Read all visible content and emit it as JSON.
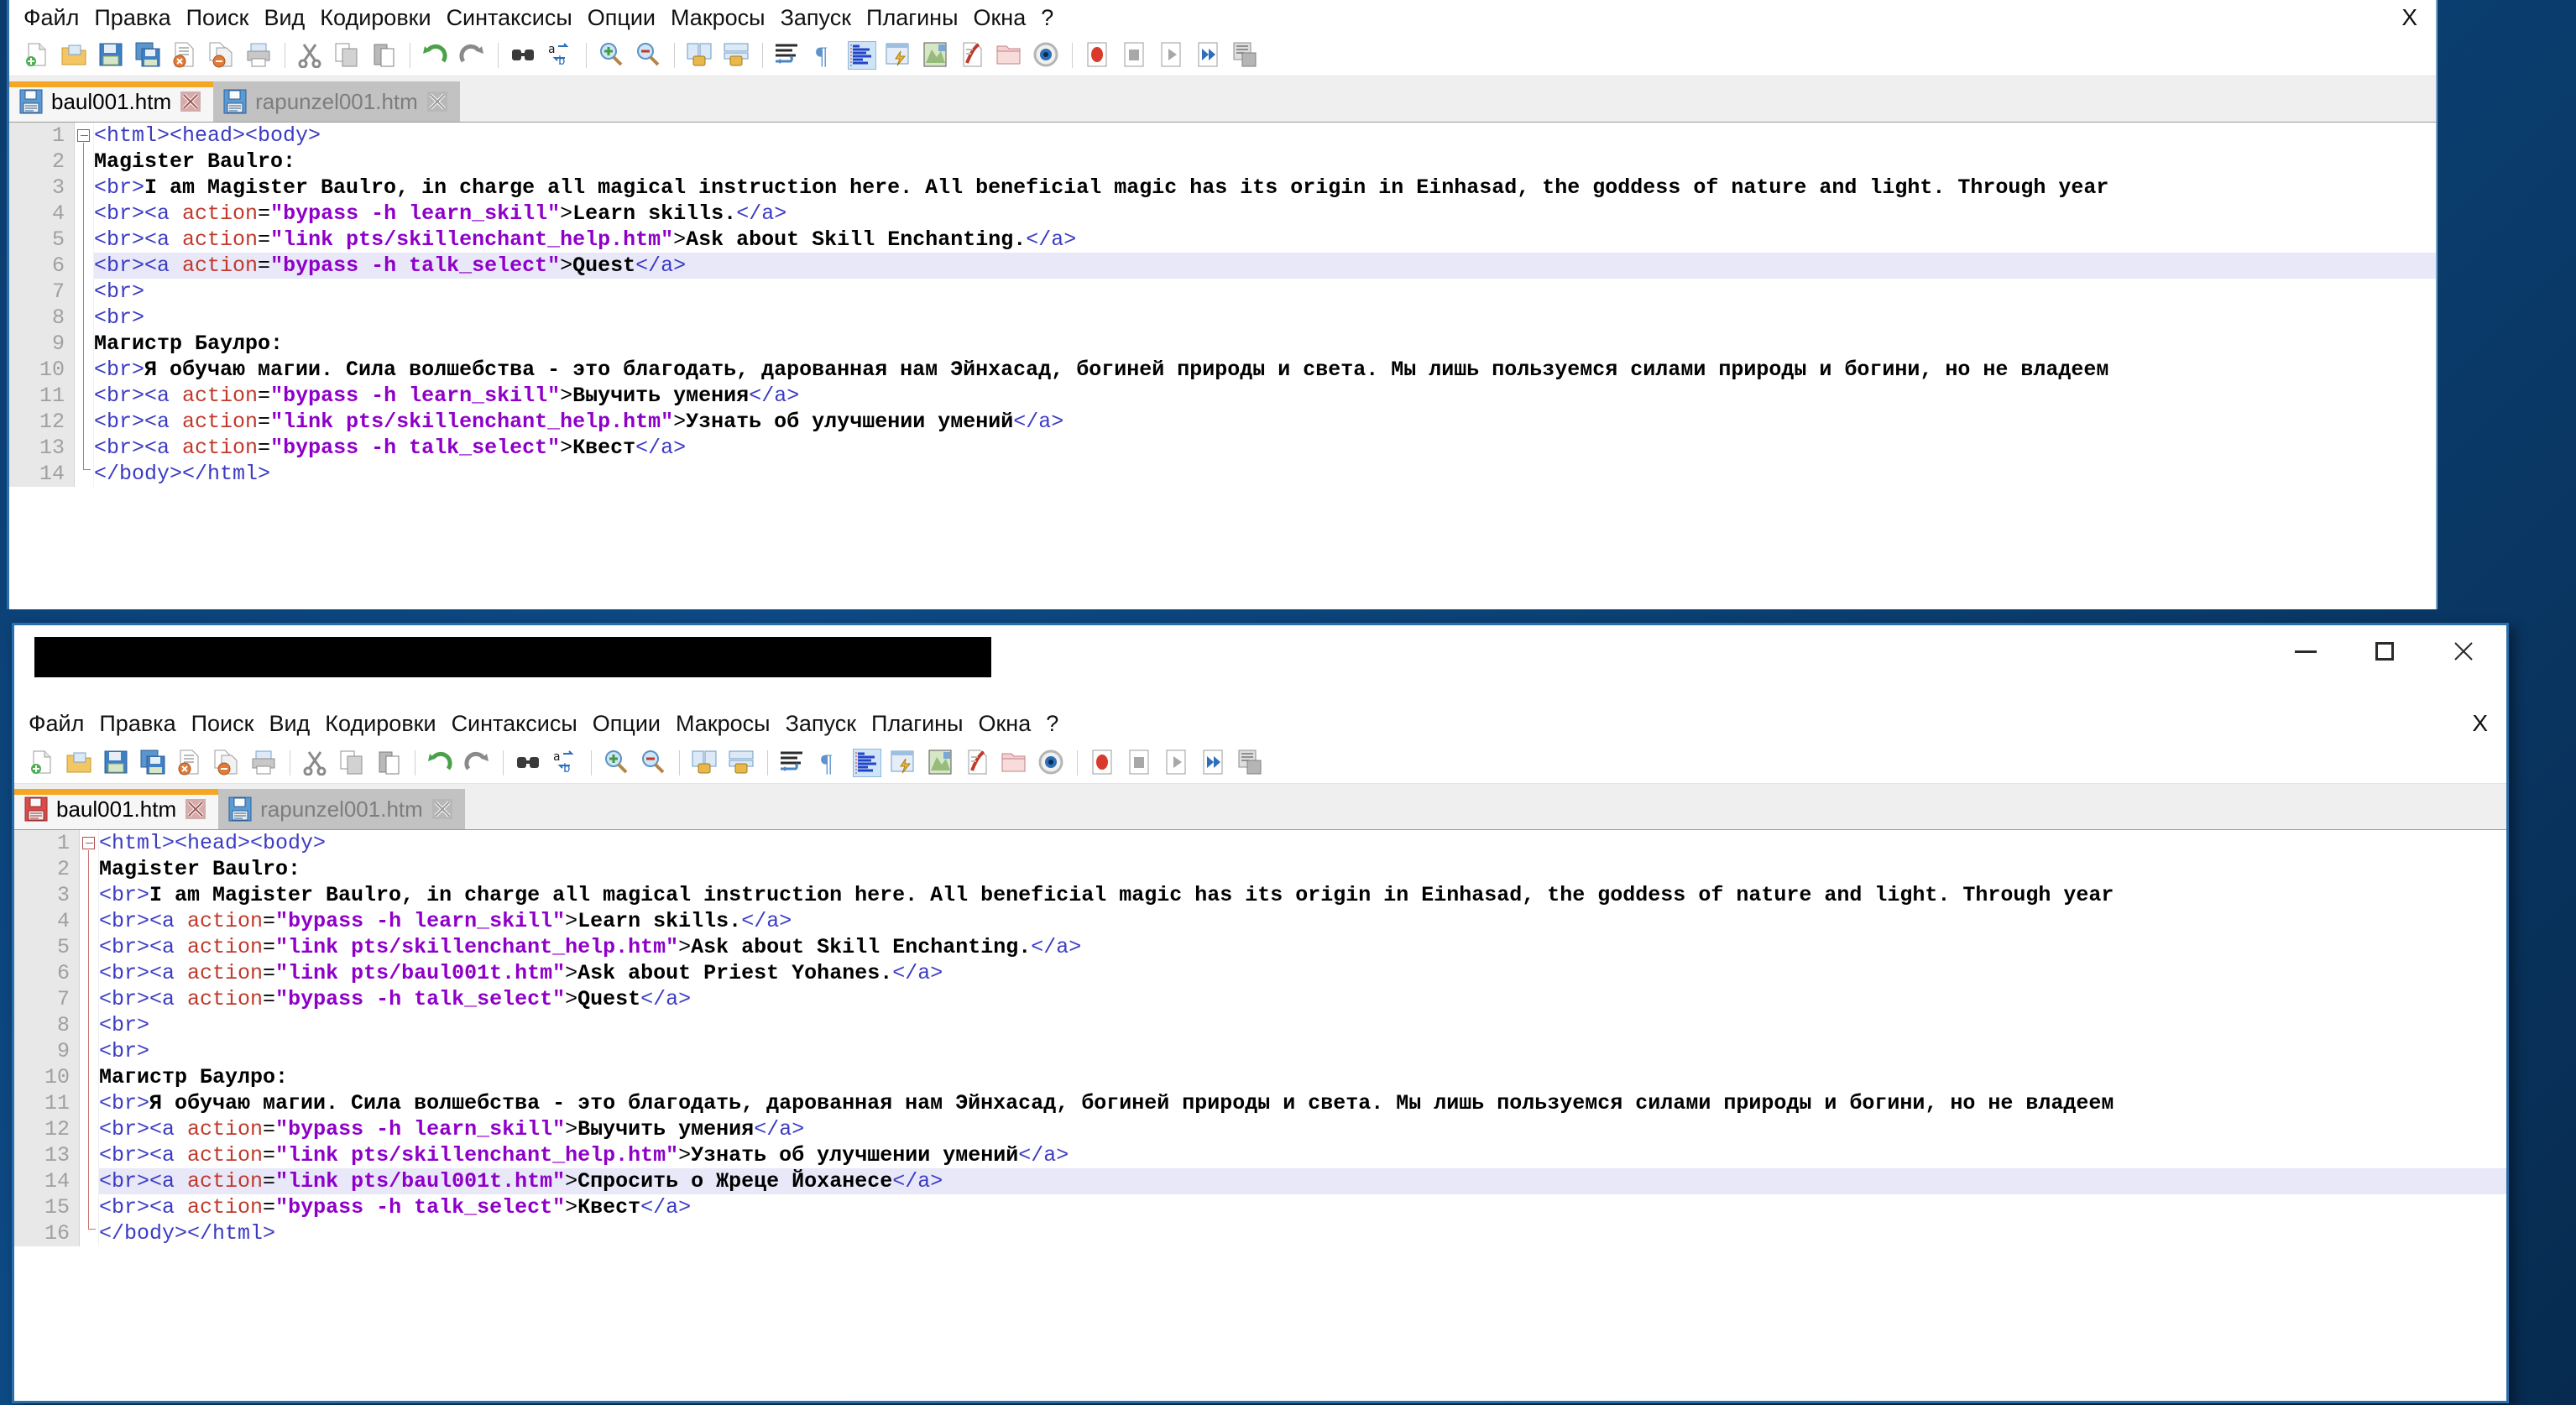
{
  "app": {
    "name": "Notepad++",
    "menu": [
      "Файл",
      "Правка",
      "Поиск",
      "Вид",
      "Кодировки",
      "Синтаксисы",
      "Опции",
      "Макросы",
      "Запуск",
      "Плагины",
      "Окна",
      "?"
    ],
    "doc_close_label": "X",
    "window_controls": {
      "minimize": "–",
      "maximize": "□",
      "close": "✕"
    },
    "toolbar_icons": [
      "new-file-icon",
      "open-folder-icon",
      "save-icon",
      "save-all-icon",
      "close-file-icon",
      "close-all-files-icon",
      "print-icon",
      "sep",
      "cut-icon",
      "copy-icon",
      "paste-icon",
      "sep",
      "undo-icon",
      "redo-icon",
      "sep",
      "find-icon",
      "replace-icon",
      "sep",
      "zoom-in-icon",
      "zoom-out-icon",
      "sep",
      "sync-vertical-scroll-icon",
      "sync-horizontal-scroll-icon",
      "sep",
      "word-wrap-icon",
      "show-all-chars-icon",
      "indent-guide-icon",
      "user-defined-dialog-icon",
      "show-document-map-icon",
      "function-list-icon",
      "folder-as-workspace-icon",
      "monitoring-icon",
      "sep",
      "macro-record-icon",
      "macro-stop-icon",
      "macro-playback-icon",
      "macro-run-multiple-icon",
      "macro-save-icon"
    ]
  },
  "windows": [
    {
      "id": "top-window",
      "title_visible": false,
      "title_redacted": false,
      "tabs": [
        {
          "label": "baul001.htm",
          "active": true,
          "modified": false,
          "icon": "floppy-blue-icon",
          "close_icon": "close-tab-icon"
        },
        {
          "label": "rapunzel001.htm",
          "active": false,
          "modified": false,
          "icon": "floppy-blue-icon",
          "close_icon": "close-tab-icon"
        }
      ],
      "current_line": 6,
      "line_numbers": [
        1,
        2,
        3,
        4,
        5,
        6,
        7,
        8,
        9,
        10,
        11,
        12,
        13,
        14
      ],
      "lines": [
        {
          "n": 1,
          "parts": [
            {
              "t": "tag",
              "s": "<html><head><body>"
            }
          ]
        },
        {
          "n": 2,
          "parts": [
            {
              "t": "txt",
              "s": "Magister Baulro:"
            }
          ]
        },
        {
          "n": 3,
          "parts": [
            {
              "t": "tag",
              "s": "<br>"
            },
            {
              "t": "txt",
              "s": "I am Magister Baulro, in charge all magical instruction here. All beneficial magic has its origin in Einhasad, the goddess of nature and light. Through year"
            }
          ]
        },
        {
          "n": 4,
          "parts": [
            {
              "t": "tag",
              "s": "<br><a "
            },
            {
              "t": "attr",
              "s": "action"
            },
            {
              "t": "punct",
              "s": "="
            },
            {
              "t": "val",
              "s": "\"bypass -h learn_skill\""
            },
            {
              "t": "punct",
              "s": ">"
            },
            {
              "t": "txt",
              "s": "Learn skills."
            },
            {
              "t": "tag",
              "s": "</a>"
            }
          ]
        },
        {
          "n": 5,
          "parts": [
            {
              "t": "tag",
              "s": "<br><a "
            },
            {
              "t": "attr",
              "s": "action"
            },
            {
              "t": "punct",
              "s": "="
            },
            {
              "t": "val",
              "s": "\"link pts/skillenchant_help.htm\""
            },
            {
              "t": "punct",
              "s": ">"
            },
            {
              "t": "txt",
              "s": "Ask about Skill Enchanting."
            },
            {
              "t": "tag",
              "s": "</a>"
            }
          ]
        },
        {
          "n": 6,
          "parts": [
            {
              "t": "tag",
              "s": "<br><a "
            },
            {
              "t": "attr",
              "s": "action"
            },
            {
              "t": "punct",
              "s": "="
            },
            {
              "t": "val",
              "s": "\"bypass -h talk_select\""
            },
            {
              "t": "punct",
              "s": ">"
            },
            {
              "t": "txt",
              "s": "Quest"
            },
            {
              "t": "tag",
              "s": "</a>"
            }
          ]
        },
        {
          "n": 7,
          "parts": [
            {
              "t": "tag",
              "s": "<br>"
            }
          ]
        },
        {
          "n": 8,
          "parts": [
            {
              "t": "tag",
              "s": "<br>"
            }
          ]
        },
        {
          "n": 9,
          "parts": [
            {
              "t": "txt",
              "s": "Магистр Баулро:"
            }
          ]
        },
        {
          "n": 10,
          "parts": [
            {
              "t": "tag",
              "s": "<br>"
            },
            {
              "t": "txt",
              "s": "Я обучаю магии. Сила волшебства - это благодать, дарованная нам Эйнхасад, богиней природы и света. Мы лишь пользуемся силами природы и богини, но не владеем"
            }
          ]
        },
        {
          "n": 11,
          "parts": [
            {
              "t": "tag",
              "s": "<br><a "
            },
            {
              "t": "attr",
              "s": "action"
            },
            {
              "t": "punct",
              "s": "="
            },
            {
              "t": "val",
              "s": "\"bypass -h learn_skill\""
            },
            {
              "t": "punct",
              "s": ">"
            },
            {
              "t": "txt",
              "s": "Выучить умения"
            },
            {
              "t": "tag",
              "s": "</a>"
            }
          ]
        },
        {
          "n": 12,
          "parts": [
            {
              "t": "tag",
              "s": "<br><a "
            },
            {
              "t": "attr",
              "s": "action"
            },
            {
              "t": "punct",
              "s": "="
            },
            {
              "t": "val",
              "s": "\"link pts/skillenchant_help.htm\""
            },
            {
              "t": "punct",
              "s": ">"
            },
            {
              "t": "txt",
              "s": "Узнать об улучшении умений"
            },
            {
              "t": "tag",
              "s": "</a>"
            }
          ]
        },
        {
          "n": 13,
          "parts": [
            {
              "t": "tag",
              "s": "<br><a "
            },
            {
              "t": "attr",
              "s": "action"
            },
            {
              "t": "punct",
              "s": "="
            },
            {
              "t": "val",
              "s": "\"bypass -h talk_select\""
            },
            {
              "t": "punct",
              "s": ">"
            },
            {
              "t": "txt",
              "s": "Квест"
            },
            {
              "t": "tag",
              "s": "</a>"
            }
          ]
        },
        {
          "n": 14,
          "parts": [
            {
              "t": "tag",
              "s": "</body></html>"
            }
          ]
        }
      ]
    },
    {
      "id": "bottom-window",
      "title_visible": false,
      "title_redacted": true,
      "tabs": [
        {
          "label": "baul001.htm",
          "active": true,
          "modified": true,
          "icon": "floppy-red-icon",
          "close_icon": "close-tab-icon"
        },
        {
          "label": "rapunzel001.htm",
          "active": false,
          "modified": false,
          "icon": "floppy-blue-icon",
          "close_icon": "close-tab-icon"
        }
      ],
      "current_line": 14,
      "line_numbers": [
        1,
        2,
        3,
        4,
        5,
        6,
        7,
        8,
        9,
        10,
        11,
        12,
        13,
        14,
        15,
        16
      ],
      "lines": [
        {
          "n": 1,
          "parts": [
            {
              "t": "tag",
              "s": "<html><head><body>"
            }
          ]
        },
        {
          "n": 2,
          "parts": [
            {
              "t": "txt",
              "s": "Magister Baulro:"
            }
          ]
        },
        {
          "n": 3,
          "parts": [
            {
              "t": "tag",
              "s": "<br>"
            },
            {
              "t": "txt",
              "s": "I am Magister Baulro, in charge all magical instruction here. All beneficial magic has its origin in Einhasad, the goddess of nature and light. Through year"
            }
          ]
        },
        {
          "n": 4,
          "parts": [
            {
              "t": "tag",
              "s": "<br><a "
            },
            {
              "t": "attr",
              "s": "action"
            },
            {
              "t": "punct",
              "s": "="
            },
            {
              "t": "val",
              "s": "\"bypass -h learn_skill\""
            },
            {
              "t": "punct",
              "s": ">"
            },
            {
              "t": "txt",
              "s": "Learn skills."
            },
            {
              "t": "tag",
              "s": "</a>"
            }
          ]
        },
        {
          "n": 5,
          "parts": [
            {
              "t": "tag",
              "s": "<br><a "
            },
            {
              "t": "attr",
              "s": "action"
            },
            {
              "t": "punct",
              "s": "="
            },
            {
              "t": "val",
              "s": "\"link pts/skillenchant_help.htm\""
            },
            {
              "t": "punct",
              "s": ">"
            },
            {
              "t": "txt",
              "s": "Ask about Skill Enchanting."
            },
            {
              "t": "tag",
              "s": "</a>"
            }
          ]
        },
        {
          "n": 6,
          "parts": [
            {
              "t": "tag",
              "s": "<br><a "
            },
            {
              "t": "attr",
              "s": "action"
            },
            {
              "t": "punct",
              "s": "="
            },
            {
              "t": "val",
              "s": "\"link pts/baul001t.htm\""
            },
            {
              "t": "punct",
              "s": ">"
            },
            {
              "t": "txt",
              "s": "Ask about Priest Yohanes."
            },
            {
              "t": "tag",
              "s": "</a>"
            }
          ]
        },
        {
          "n": 7,
          "parts": [
            {
              "t": "tag",
              "s": "<br><a "
            },
            {
              "t": "attr",
              "s": "action"
            },
            {
              "t": "punct",
              "s": "="
            },
            {
              "t": "val",
              "s": "\"bypass -h talk_select\""
            },
            {
              "t": "punct",
              "s": ">"
            },
            {
              "t": "txt",
              "s": "Quest"
            },
            {
              "t": "tag",
              "s": "</a>"
            }
          ]
        },
        {
          "n": 8,
          "parts": [
            {
              "t": "tag",
              "s": "<br>"
            }
          ]
        },
        {
          "n": 9,
          "parts": [
            {
              "t": "tag",
              "s": "<br>"
            }
          ]
        },
        {
          "n": 10,
          "parts": [
            {
              "t": "txt",
              "s": "Магистр Баулро:"
            }
          ]
        },
        {
          "n": 11,
          "parts": [
            {
              "t": "tag",
              "s": "<br>"
            },
            {
              "t": "txt",
              "s": "Я обучаю магии. Сила волшебства - это благодать, дарованная нам Эйнхасад, богиней природы и света. Мы лишь пользуемся силами природы и богини, но не владеем"
            }
          ]
        },
        {
          "n": 12,
          "parts": [
            {
              "t": "tag",
              "s": "<br><a "
            },
            {
              "t": "attr",
              "s": "action"
            },
            {
              "t": "punct",
              "s": "="
            },
            {
              "t": "val",
              "s": "\"bypass -h learn_skill\""
            },
            {
              "t": "punct",
              "s": ">"
            },
            {
              "t": "txt",
              "s": "Выучить умения"
            },
            {
              "t": "tag",
              "s": "</a>"
            }
          ]
        },
        {
          "n": 13,
          "parts": [
            {
              "t": "tag",
              "s": "<br><a "
            },
            {
              "t": "attr",
              "s": "action"
            },
            {
              "t": "punct",
              "s": "="
            },
            {
              "t": "val",
              "s": "\"link pts/skillenchant_help.htm\""
            },
            {
              "t": "punct",
              "s": ">"
            },
            {
              "t": "txt",
              "s": "Узнать об улучшении умений"
            },
            {
              "t": "tag",
              "s": "</a>"
            }
          ]
        },
        {
          "n": 14,
          "parts": [
            {
              "t": "tag",
              "s": "<br><a "
            },
            {
              "t": "attr",
              "s": "action"
            },
            {
              "t": "punct",
              "s": "="
            },
            {
              "t": "val",
              "s": "\"link pts/baul001t.htm\""
            },
            {
              "t": "punct",
              "s": ">"
            },
            {
              "t": "txt",
              "s": "Спросить о Жреце Йоханесе"
            },
            {
              "t": "tag",
              "s": "</a>"
            }
          ]
        },
        {
          "n": 15,
          "parts": [
            {
              "t": "tag",
              "s": "<br><a "
            },
            {
              "t": "attr",
              "s": "action"
            },
            {
              "t": "punct",
              "s": "="
            },
            {
              "t": "val",
              "s": "\"bypass -h talk_select\""
            },
            {
              "t": "punct",
              "s": ">"
            },
            {
              "t": "txt",
              "s": "Квест"
            },
            {
              "t": "tag",
              "s": "</a>"
            }
          ]
        },
        {
          "n": 16,
          "parts": [
            {
              "t": "tag",
              "s": "</body></html>"
            }
          ]
        }
      ]
    }
  ],
  "colors": {
    "tag": "#3b3bc4",
    "attribute": "#c0392b",
    "value": "#8e00c8",
    "text": "#000000",
    "current_line_highlight": "#e8e8f8",
    "active_tab_accent": "#f5a623",
    "window_border": "#2b6eaa",
    "desktop": "#0d4a85"
  }
}
